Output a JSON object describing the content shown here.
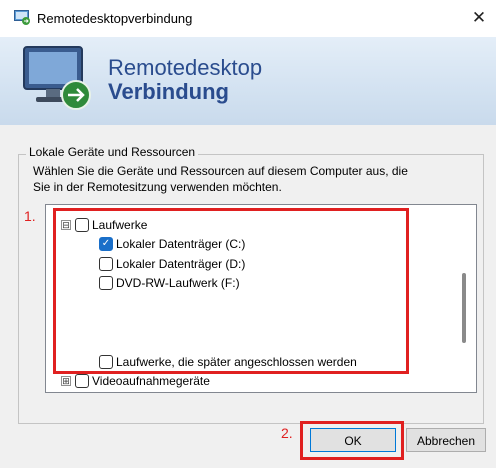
{
  "window": {
    "title": "Remotedesktopverbindung",
    "close_glyph": "✕",
    "icon": "remote-desktop-icon"
  },
  "banner": {
    "line1": "Remotedesktop",
    "line2": "Verbindung",
    "icon": "remote-desktop-monitor-icon"
  },
  "group": {
    "legend": "Lokale Geräte und Ressourcen",
    "description_line1": "Wählen Sie die Geräte und Ressourcen auf diesem Computer aus, die",
    "description_line2": "Sie in der Remotesitzung verwenden möchten."
  },
  "tree": {
    "drives": {
      "label": "Laufwerke",
      "expander": "⊟",
      "checked": false
    },
    "items": [
      {
        "label": "Lokaler Datenträger (C:)",
        "checked": true
      },
      {
        "label": "Lokaler Datenträger (D:)",
        "checked": false
      },
      {
        "label": "DVD-RW-Laufwerk (F:)",
        "checked": false
      }
    ],
    "later_drives": {
      "label": "Laufwerke, die später angeschlossen werden",
      "checked": false
    },
    "video": {
      "label": "Videoaufnahmegeräte",
      "expander": "⊞",
      "checked": false
    }
  },
  "annotations": {
    "step1": "1.",
    "step2": "2.",
    "color": "#e02020"
  },
  "buttons": {
    "ok": "OK",
    "cancel": "Abbrechen"
  }
}
